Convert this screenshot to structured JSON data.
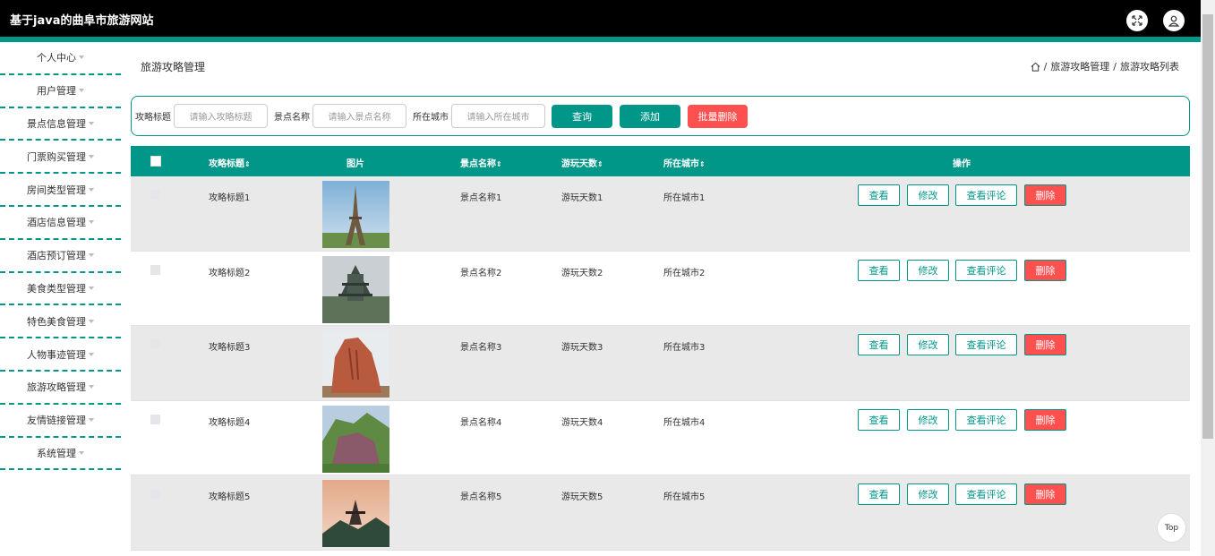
{
  "app": {
    "title": "基于java的曲阜市旅游网站"
  },
  "sidebar": {
    "items": [
      {
        "label": "个人中心"
      },
      {
        "label": "用户管理"
      },
      {
        "label": "景点信息管理"
      },
      {
        "label": "门票购买管理"
      },
      {
        "label": "房间类型管理"
      },
      {
        "label": "酒店信息管理"
      },
      {
        "label": "酒店预订管理"
      },
      {
        "label": "美食类型管理"
      },
      {
        "label": "特色美食管理"
      },
      {
        "label": "人物事迹管理"
      },
      {
        "label": "旅游攻略管理"
      },
      {
        "label": "友情链接管理"
      },
      {
        "label": "系统管理"
      }
    ]
  },
  "page": {
    "title": "旅游攻略管理",
    "breadcrumb": [
      "旅游攻略管理",
      "旅游攻略列表"
    ]
  },
  "search": {
    "title_label": "攻略标题",
    "title_placeholder": "请输入攻略标题",
    "spot_label": "景点名称",
    "spot_placeholder": "请输入景点名称",
    "city_label": "所在城市",
    "city_placeholder": "请输入所在城市",
    "query_label": "查询",
    "add_label": "添加",
    "batch_delete_label": "批量删除"
  },
  "table": {
    "headers": {
      "title": "攻略标题",
      "image": "图片",
      "spot": "景点名称",
      "days": "游玩天数",
      "city": "所在城市",
      "actions": "操作"
    },
    "actions": {
      "view": "查看",
      "edit": "修改",
      "comments": "查看评论",
      "delete": "删除"
    },
    "rows": [
      {
        "title": "攻略标题1",
        "spot": "景点名称1",
        "days": "游玩天数1",
        "city": "所在城市1"
      },
      {
        "title": "攻略标题2",
        "spot": "景点名称2",
        "days": "游玩天数2",
        "city": "所在城市2"
      },
      {
        "title": "攻略标题3",
        "spot": "景点名称3",
        "days": "游玩天数3",
        "city": "所在城市3"
      },
      {
        "title": "攻略标题4",
        "spot": "景点名称4",
        "days": "游玩天数4",
        "city": "所在城市4"
      },
      {
        "title": "攻略标题5",
        "spot": "景点名称5",
        "days": "游玩天数5",
        "city": "所在城市5"
      }
    ]
  },
  "back_to_top": "Top",
  "colors": {
    "accent": "#009688",
    "danger": "#ff5050",
    "header_bg": "#000000"
  }
}
